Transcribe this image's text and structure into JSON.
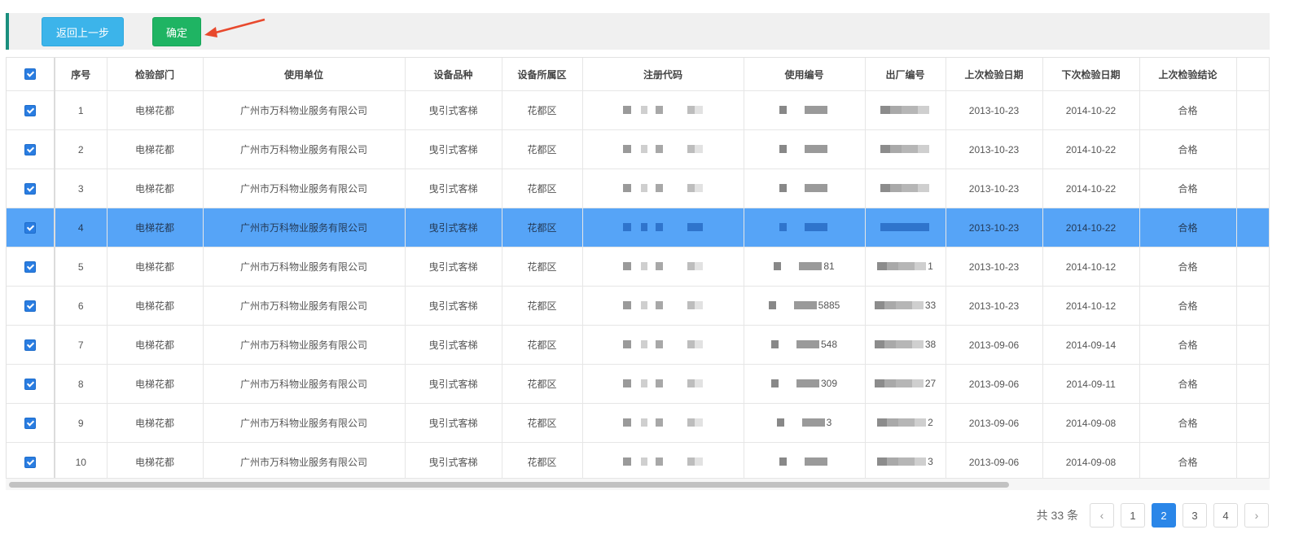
{
  "toolbar": {
    "back_label": "返回上一步",
    "confirm_label": "确定"
  },
  "table": {
    "headers": [
      "序号",
      "检验部门",
      "使用单位",
      "设备品种",
      "设备所属区",
      "注册代码",
      "使用编号",
      "出厂编号",
      "上次检验日期",
      "下次检验日期",
      "上次检验结论"
    ],
    "rows": [
      {
        "no": "1",
        "dept": "电梯花都",
        "unit": "广州市万科物业服务有限公司",
        "type": "曳引式客梯",
        "area": "花都区",
        "use_no": "",
        "factory_no": "",
        "last": "2013-10-23",
        "next": "2014-10-22",
        "result": "合格"
      },
      {
        "no": "2",
        "dept": "电梯花都",
        "unit": "广州市万科物业服务有限公司",
        "type": "曳引式客梯",
        "area": "花都区",
        "use_no": "",
        "factory_no": "",
        "last": "2013-10-23",
        "next": "2014-10-22",
        "result": "合格"
      },
      {
        "no": "3",
        "dept": "电梯花都",
        "unit": "广州市万科物业服务有限公司",
        "type": "曳引式客梯",
        "area": "花都区",
        "use_no": "",
        "factory_no": "",
        "last": "2013-10-23",
        "next": "2014-10-22",
        "result": "合格"
      },
      {
        "no": "4",
        "dept": "电梯花都",
        "unit": "广州市万科物业服务有限公司",
        "type": "曳引式客梯",
        "area": "花都区",
        "use_no": "",
        "factory_no": "",
        "last": "2013-10-23",
        "next": "2014-10-22",
        "result": "合格",
        "selected": true
      },
      {
        "no": "5",
        "dept": "电梯花都",
        "unit": "广州市万科物业服务有限公司",
        "type": "曳引式客梯",
        "area": "花都区",
        "use_no": "81",
        "factory_no": "1",
        "last": "2013-10-23",
        "next": "2014-10-12",
        "result": "合格"
      },
      {
        "no": "6",
        "dept": "电梯花都",
        "unit": "广州市万科物业服务有限公司",
        "type": "曳引式客梯",
        "area": "花都区",
        "use_no": "5885",
        "factory_no": "33",
        "last": "2013-10-23",
        "next": "2014-10-12",
        "result": "合格"
      },
      {
        "no": "7",
        "dept": "电梯花都",
        "unit": "广州市万科物业服务有限公司",
        "type": "曳引式客梯",
        "area": "花都区",
        "use_no": "548",
        "factory_no": "38",
        "last": "2013-09-06",
        "next": "2014-09-14",
        "result": "合格"
      },
      {
        "no": "8",
        "dept": "电梯花都",
        "unit": "广州市万科物业服务有限公司",
        "type": "曳引式客梯",
        "area": "花都区",
        "use_no": "309",
        "factory_no": "27",
        "last": "2013-09-06",
        "next": "2014-09-11",
        "result": "合格"
      },
      {
        "no": "9",
        "dept": "电梯花都",
        "unit": "广州市万科物业服务有限公司",
        "type": "曳引式客梯",
        "area": "花都区",
        "use_no": "3",
        "factory_no": "2",
        "last": "2013-09-06",
        "next": "2014-09-08",
        "result": "合格"
      },
      {
        "no": "10",
        "dept": "电梯花都",
        "unit": "广州市万科物业服务有限公司",
        "type": "曳引式客梯",
        "area": "花都区",
        "use_no": "",
        "factory_no": "3",
        "last": "2013-09-06",
        "next": "2014-09-08",
        "result": "合格"
      }
    ]
  },
  "pagination": {
    "total_label": "共 33 条",
    "pages": [
      "1",
      "2",
      "3",
      "4"
    ],
    "current": "2",
    "prev_icon": "chevron-left-icon",
    "next_icon": "chevron-right-icon"
  },
  "colors": {
    "accent": "#2a86e8",
    "selected_row": "#56a4f7",
    "back_button": "#3cb4ea",
    "confirm_button": "#1fb463",
    "toolbar_bar": "#1a8f7e",
    "arrow": "#e8492d"
  }
}
